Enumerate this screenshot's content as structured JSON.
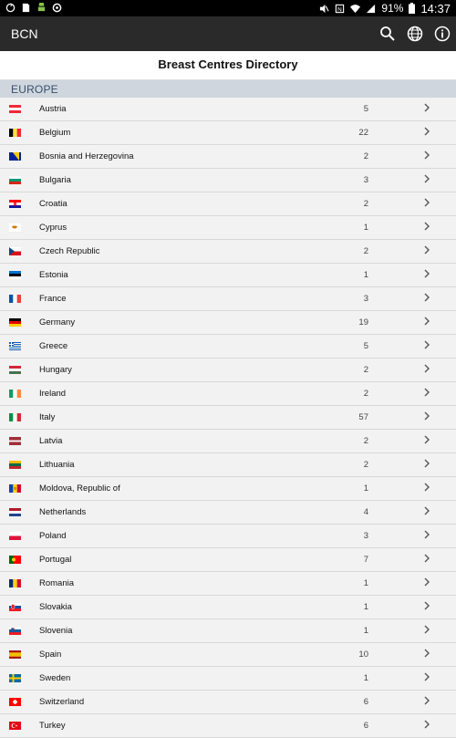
{
  "status_bar": {
    "time": "14:37",
    "battery": "91%"
  },
  "app_bar": {
    "title": "BCN",
    "actions": [
      "search-icon",
      "globe-icon",
      "info-icon"
    ]
  },
  "header": {
    "title": "Breast Centres Directory"
  },
  "section": {
    "label": "EUROPE"
  },
  "countries": [
    {
      "name": "Austria",
      "count": "5",
      "flag": "austria"
    },
    {
      "name": "Belgium",
      "count": "22",
      "flag": "belgium"
    },
    {
      "name": "Bosnia and Herzegovina",
      "count": "2",
      "flag": "bosnia"
    },
    {
      "name": "Bulgaria",
      "count": "3",
      "flag": "bulgaria"
    },
    {
      "name": "Croatia",
      "count": "2",
      "flag": "croatia"
    },
    {
      "name": "Cyprus",
      "count": "1",
      "flag": "cyprus"
    },
    {
      "name": "Czech Republic",
      "count": "2",
      "flag": "czech"
    },
    {
      "name": "Estonia",
      "count": "1",
      "flag": "estonia"
    },
    {
      "name": "France",
      "count": "3",
      "flag": "france"
    },
    {
      "name": "Germany",
      "count": "19",
      "flag": "germany"
    },
    {
      "name": "Greece",
      "count": "5",
      "flag": "greece"
    },
    {
      "name": "Hungary",
      "count": "2",
      "flag": "hungary"
    },
    {
      "name": "Ireland",
      "count": "2",
      "flag": "ireland"
    },
    {
      "name": "Italy",
      "count": "57",
      "flag": "italy"
    },
    {
      "name": "Latvia",
      "count": "2",
      "flag": "latvia"
    },
    {
      "name": "Lithuania",
      "count": "2",
      "flag": "lithuania"
    },
    {
      "name": "Moldova, Republic of",
      "count": "1",
      "flag": "moldova"
    },
    {
      "name": "Netherlands",
      "count": "4",
      "flag": "netherlands"
    },
    {
      "name": "Poland",
      "count": "3",
      "flag": "poland"
    },
    {
      "name": "Portugal",
      "count": "7",
      "flag": "portugal"
    },
    {
      "name": "Romania",
      "count": "1",
      "flag": "romania"
    },
    {
      "name": "Slovakia",
      "count": "1",
      "flag": "slovakia"
    },
    {
      "name": "Slovenia",
      "count": "1",
      "flag": "slovenia"
    },
    {
      "name": "Spain",
      "count": "10",
      "flag": "spain"
    },
    {
      "name": "Sweden",
      "count": "1",
      "flag": "sweden"
    },
    {
      "name": "Switzerland",
      "count": "6",
      "flag": "switzerland"
    },
    {
      "name": "Turkey",
      "count": "6",
      "flag": "turkey"
    }
  ]
}
